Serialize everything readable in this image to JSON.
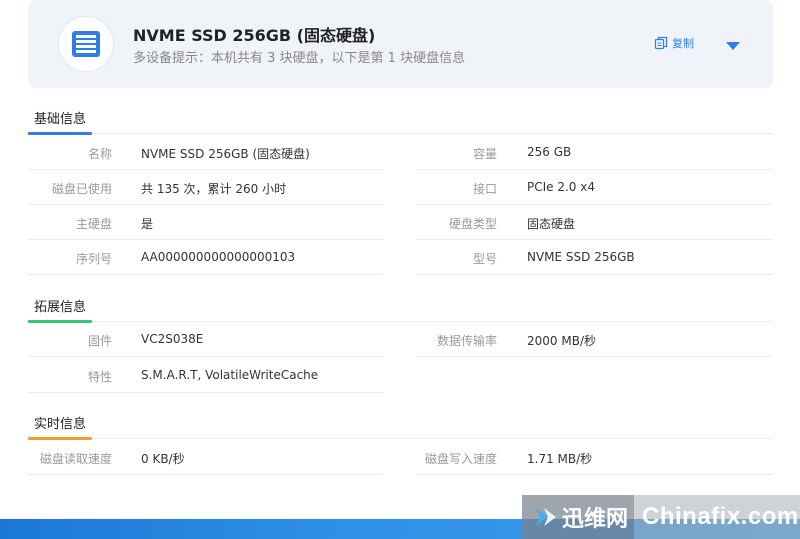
{
  "header": {
    "title": "NVME SSD 256GB (固态硬盘)",
    "hint": "多设备提示：本机共有 3 块硬盘，以下是第 1 块硬盘信息",
    "copy_label": "复制",
    "icon": "disk-drive-icon"
  },
  "sections": {
    "basic": {
      "title": "基础信息",
      "rows": [
        {
          "left_label": "名称",
          "left_value": "NVME SSD 256GB (固态硬盘)",
          "right_label": "容量",
          "right_value": "256 GB"
        },
        {
          "left_label": "磁盘已使用",
          "left_value": "共 135 次，累计 260 小时",
          "right_label": "接口",
          "right_value": "PCIe 2.0 x4"
        },
        {
          "left_label": "主硬盘",
          "left_value": "是",
          "right_label": "硬盘类型",
          "right_value": "固态硬盘"
        },
        {
          "left_label": "序列号",
          "left_value": "AA000000000000000103",
          "right_label": "型号",
          "right_value": "NVME SSD 256GB"
        }
      ]
    },
    "extended": {
      "title": "拓展信息",
      "rows": [
        {
          "left_label": "固件",
          "left_value": "VC2S038E",
          "right_label": "数据传输率",
          "right_value": "2000 MB/秒"
        },
        {
          "left_label": "特性",
          "left_value": "S.M.A.R.T, VolatileWriteCache"
        }
      ]
    },
    "realtime": {
      "title": "实时信息",
      "rows": [
        {
          "left_label": "磁盘读取速度",
          "left_value": "0 KB/秒",
          "right_label": "磁盘写入速度",
          "right_value": "1.71 MB/秒"
        }
      ]
    }
  },
  "colors": {
    "accent_blue": "#2f7ee6",
    "underline_basic": "#2f7ee6",
    "underline_extended": "#3cc47c",
    "underline_realtime": "#f0a030"
  },
  "watermark": {
    "cn": "迅维网",
    "en": "Chinafix.com"
  }
}
